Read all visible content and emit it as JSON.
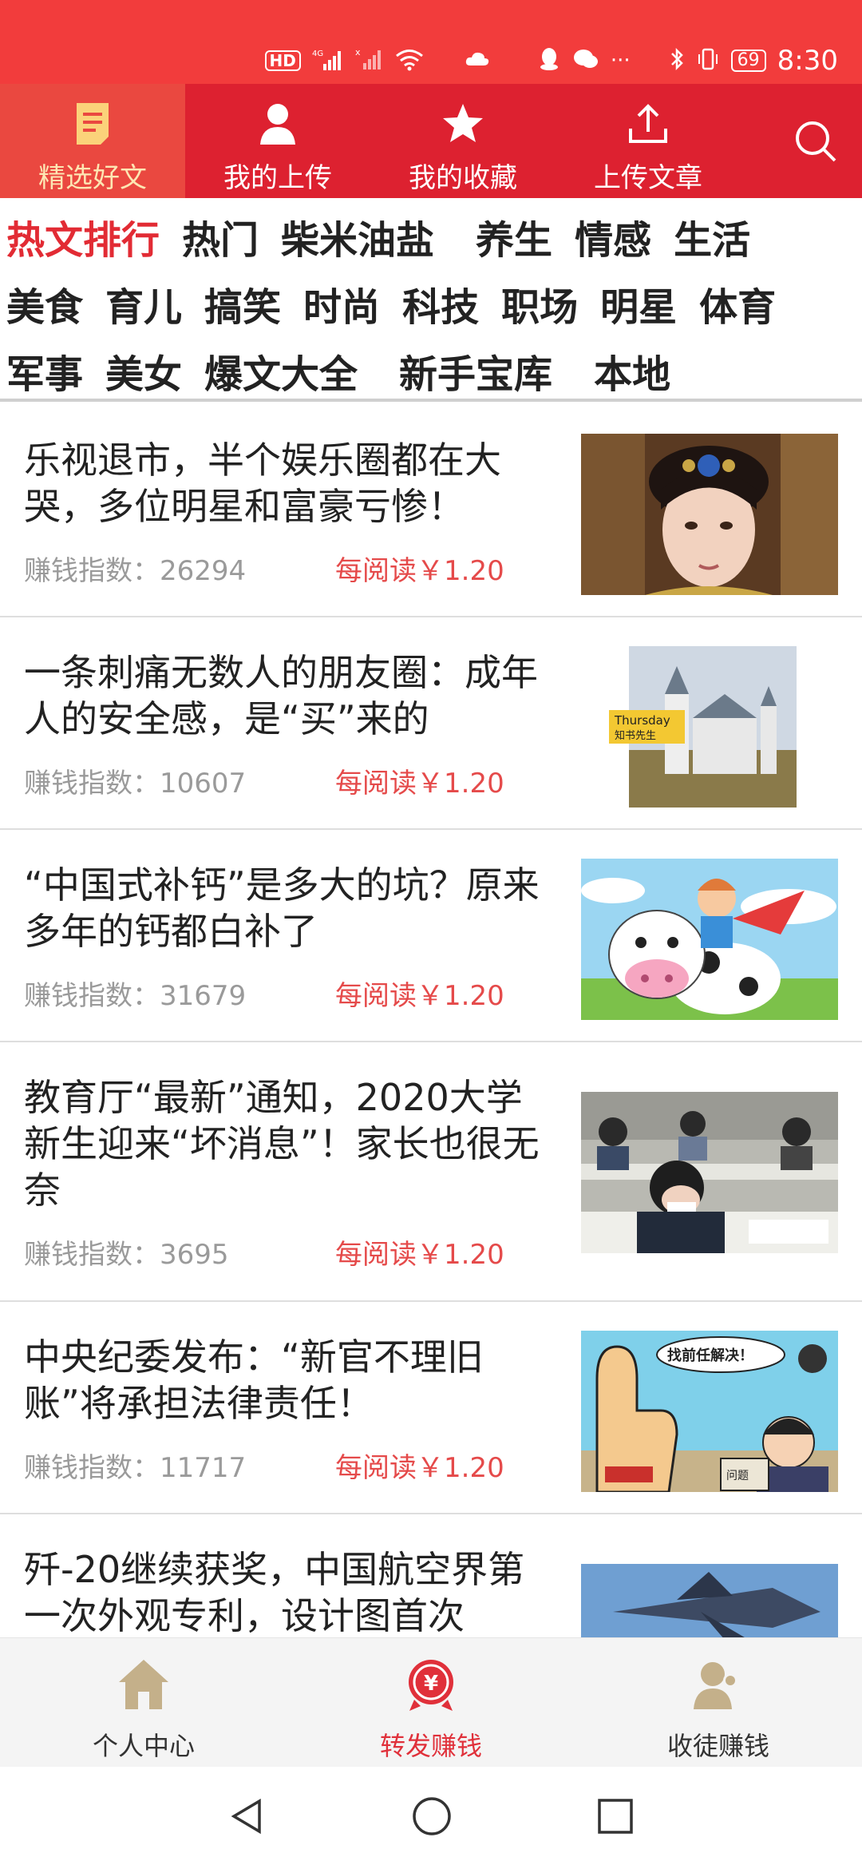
{
  "status_bar": {
    "network_hd": "HD",
    "network_type": "4G",
    "battery": "69",
    "time": "8:30",
    "icons": [
      "hd-icon",
      "signal-4g-icon",
      "signal-nosim-icon",
      "wifi-icon",
      "cloud-icon",
      "qq-icon",
      "wechat-icon",
      "more-icon",
      "bluetooth-icon",
      "vibrate-icon",
      "battery-icon"
    ]
  },
  "top_nav": {
    "items": [
      {
        "label": "精选好文",
        "icon": "article-icon",
        "active": true
      },
      {
        "label": "我的上传",
        "icon": "user-icon",
        "active": false
      },
      {
        "label": "我的收藏",
        "icon": "star-icon",
        "active": false
      },
      {
        "label": "上传文章",
        "icon": "upload-icon",
        "active": false
      }
    ],
    "search_icon": "search-icon"
  },
  "categories": {
    "rows": [
      [
        "热文排行",
        "热门",
        "柴米油盐",
        "养生",
        "情感",
        "生活"
      ],
      [
        "美食",
        "育儿",
        "搞笑",
        "时尚",
        "科技",
        "职场",
        "明星",
        "体育"
      ],
      [
        "军事",
        "美女",
        "爆文大全",
        "新手宝库",
        "本地"
      ]
    ],
    "active": "热文排行"
  },
  "articles": [
    {
      "title": "乐视退市，半个娱乐圈都在大哭，多位明星和富豪亏惨！",
      "index_label": "赚钱指数：",
      "index": "26294",
      "price": "每阅读￥1.20",
      "thumb": "actress-portrait"
    },
    {
      "title": "一条刺痛无数人的朋友圈：成年人的安全感，是“买”来的",
      "index_label": "赚钱指数：",
      "index": "10607",
      "price": "每阅读￥1.20",
      "thumb": "castle",
      "thumb_text_1": "Thursday",
      "thumb_text_2": "知书先生"
    },
    {
      "title": "“中国式补钙”是多大的坑？原来多年的钙都白补了",
      "index_label": "赚钱指数：",
      "index": "31679",
      "price": "每阅读￥1.20",
      "thumb": "cartoon-cow"
    },
    {
      "title": "教育厅“最新”通知，2020大学新生迎来“坏消息”！家长也很无奈",
      "index_label": "赚钱指数：",
      "index": "3695",
      "price": "每阅读￥1.20",
      "thumb": "students-exam"
    },
    {
      "title": "中央纪委发布：“新官不理旧账”将承担法律责任！",
      "index_label": "赚钱指数：",
      "index": "11717",
      "price": "每阅读￥1.20",
      "thumb": "cartoon-official",
      "thumb_text_1": "找前任解决！",
      "thumb_text_2": "问题"
    },
    {
      "title": "歼-20继续获奖，中国航空界第一次外观专利，设计图首次",
      "thumb": "jet"
    }
  ],
  "bottom_tabs": [
    {
      "label": "个人中心",
      "icon": "home-icon",
      "active": false
    },
    {
      "label": "转发赚钱",
      "icon": "yuan-coin-icon",
      "active": true
    },
    {
      "label": "收徒赚钱",
      "icon": "person-add-icon",
      "active": false
    }
  ],
  "colors": {
    "brand_red": "#dd2130",
    "status_red": "#f23c3c",
    "active_tab_bg": "#ea4840",
    "active_text": "#e22b34",
    "price_red": "#e54a4a",
    "icon_gold": "#c4b08a"
  }
}
